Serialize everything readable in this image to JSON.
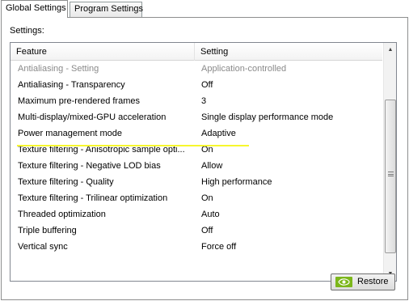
{
  "tabs": [
    {
      "label": "Global Settings",
      "active": true
    },
    {
      "label": "Program Settings",
      "active": false
    }
  ],
  "settings_label": "Settings:",
  "table": {
    "columns": [
      "Feature",
      "Setting"
    ],
    "rows": [
      {
        "feature": "Antialiasing - Setting",
        "setting": "Application-controlled",
        "disabled": true
      },
      {
        "feature": "Antialiasing - Transparency",
        "setting": "Off"
      },
      {
        "feature": "Maximum pre-rendered frames",
        "setting": "3"
      },
      {
        "feature": "Multi-display/mixed-GPU acceleration",
        "setting": "Single display performance mode"
      },
      {
        "feature": "Power management mode",
        "setting": "Adaptive",
        "highlighted": true
      },
      {
        "feature": "Texture filtering - Anisotropic sample opti...",
        "setting": "On"
      },
      {
        "feature": "Texture filtering - Negative LOD bias",
        "setting": "Allow"
      },
      {
        "feature": "Texture filtering - Quality",
        "setting": "High performance"
      },
      {
        "feature": "Texture filtering - Trilinear optimization",
        "setting": "On"
      },
      {
        "feature": "Threaded optimization",
        "setting": "Auto"
      },
      {
        "feature": "Triple buffering",
        "setting": "Off"
      },
      {
        "feature": "Vertical sync",
        "setting": "Force off"
      }
    ]
  },
  "restore_button": {
    "label": "Restore",
    "icon": "nvidia-logo-icon"
  },
  "colors": {
    "highlight": "#f7f72e",
    "nvidia_green": "#7cb71b",
    "disabled_text": "#8a8a8a"
  }
}
